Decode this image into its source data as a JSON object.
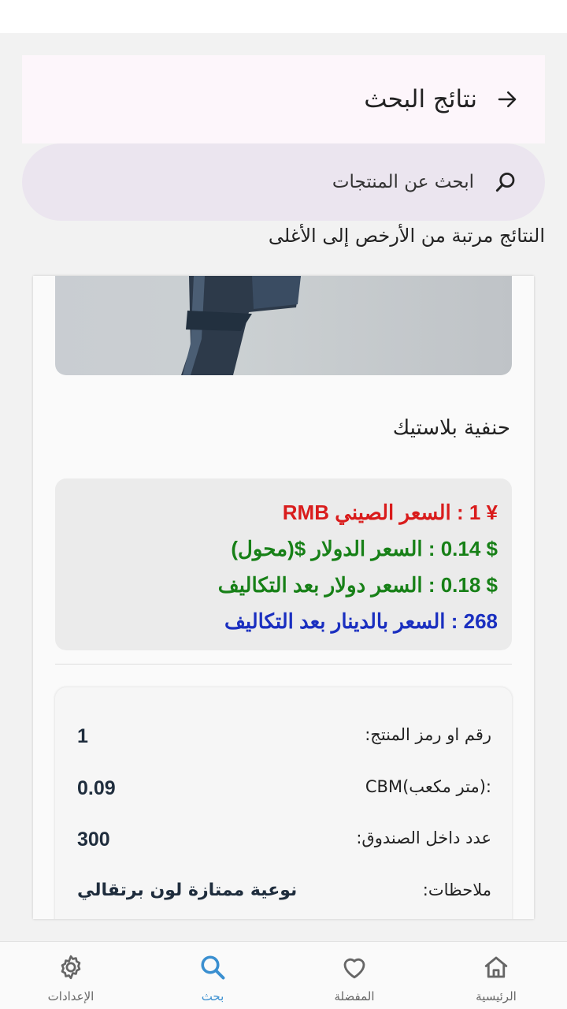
{
  "header": {
    "title": "نتائج البحث"
  },
  "search": {
    "placeholder": "ابحث عن المنتجات"
  },
  "sort_note": "النتائج مرتبة من الأرخص إلى الأغلى",
  "product": {
    "name": "حنفية بلاستيك",
    "prices": {
      "rmb": "¥ 1 : السعر الصيني RMB",
      "usd": "$ 0.14 : السعر الدولار $(محول)",
      "usd_costs": "$ 0.18 : السعر دولار بعد التكاليف",
      "dinar_costs": "268 : السعر بالدينار بعد التكاليف"
    },
    "details": [
      {
        "label": "رقم او رمز المنتج:",
        "value": "1"
      },
      {
        "label": ":(متر مكعب)CBM",
        "value": "0.09"
      },
      {
        "label": "عدد داخل الصندوق:",
        "value": "300"
      },
      {
        "label": "ملاحظات:",
        "value": "نوعية ممتازة لون برتقالي"
      }
    ]
  },
  "nav": {
    "settings": "الإعدادات",
    "search": "بحث",
    "favorites": "المفضلة",
    "home": "الرئيسية"
  },
  "colors": {
    "price_red": "#d91c1c",
    "price_green": "#178017",
    "price_blue": "#1a2fc0",
    "nav_active": "#3a8fd0"
  }
}
